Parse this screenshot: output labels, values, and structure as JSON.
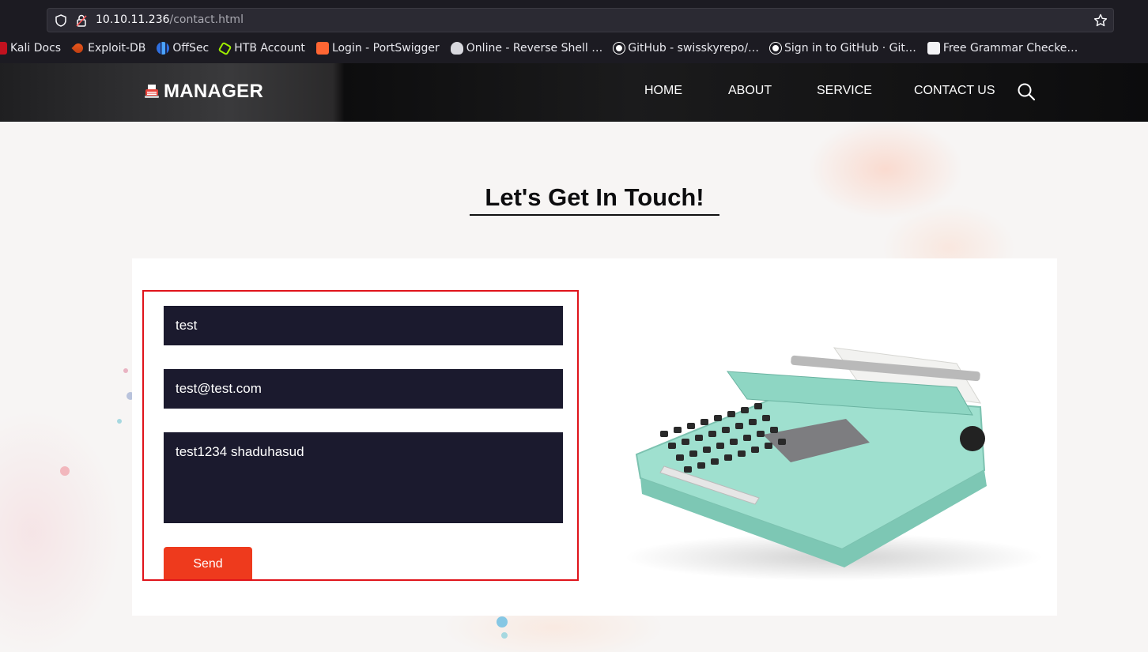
{
  "browser": {
    "url_host": "10.10.11.236",
    "url_path": "/contact.html",
    "bookmarks": [
      {
        "label": "Kali Docs",
        "icon": "kali-icon"
      },
      {
        "label": "Exploit-DB",
        "icon": "exploit-db-icon"
      },
      {
        "label": "OffSec",
        "icon": "offsec-icon"
      },
      {
        "label": "HTB Account",
        "icon": "htb-icon"
      },
      {
        "label": "Login - PortSwigger",
        "icon": "portswigger-icon"
      },
      {
        "label": "Online - Reverse Shell …",
        "icon": "skull-icon"
      },
      {
        "label": "GitHub - swisskyrepo/…",
        "icon": "github-icon"
      },
      {
        "label": "Sign in to GitHub · Git…",
        "icon": "github-icon"
      },
      {
        "label": "Free Grammar Checke…",
        "icon": "grammar-icon"
      }
    ]
  },
  "header": {
    "logo_text": "MANAGER",
    "nav": [
      "HOME",
      "ABOUT",
      "SERVICE",
      "CONTACT US"
    ]
  },
  "contact": {
    "title": "Let's Get In Touch!",
    "name_value": "test",
    "email_value": "test@test.com",
    "message_value": "test1234 shaduhasud",
    "send_label": "Send"
  },
  "colors": {
    "accent": "#ee3a1d",
    "field_bg": "#1b1a2e",
    "highlight_border": "#e0141b"
  }
}
